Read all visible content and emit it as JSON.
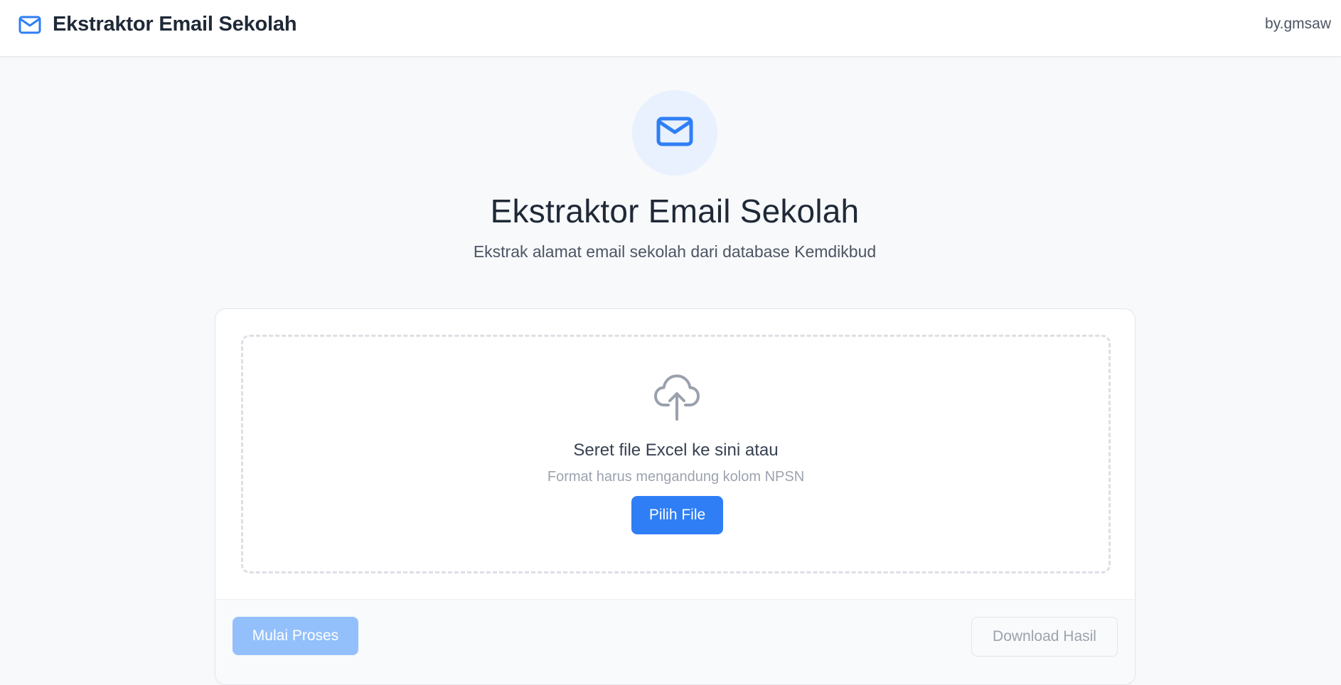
{
  "header": {
    "brand_icon": "mail-icon",
    "title": "Ekstraktor Email Sekolah",
    "credit": "by.gmsaw"
  },
  "hero": {
    "icon": "mail-icon",
    "title": "Ekstraktor Email Sekolah",
    "subtitle": "Ekstrak alamat email sekolah dari database Kemdikbud"
  },
  "upload": {
    "icon": "cloud-upload-icon",
    "instruction": "Seret file Excel ke sini atau",
    "hint": "Format harus mengandung kolom NPSN",
    "pick_label": "Pilih File"
  },
  "actions": {
    "start_label": "Mulai Proses",
    "download_label": "Download Hasil"
  },
  "colors": {
    "accent": "#2f7ef6",
    "accent_disabled": "#93c0fb",
    "icon_bg": "#e8f1fd",
    "page_bg": "#f8f9fb"
  }
}
